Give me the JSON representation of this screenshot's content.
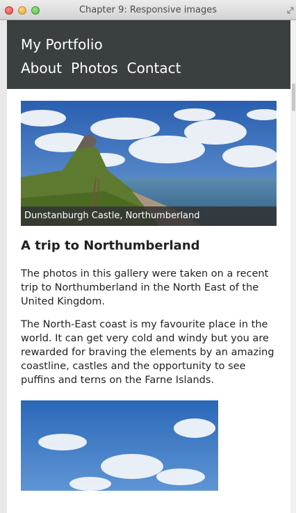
{
  "window": {
    "title": "Chapter 9: Responsive images"
  },
  "site": {
    "title": "My Portfolio",
    "nav": [
      "About",
      "Photos",
      "Contact"
    ]
  },
  "hero": {
    "caption": "Dunstanburgh Castle, Northumberland"
  },
  "article": {
    "heading": "A trip to Northumberland",
    "paragraphs": [
      "The photos in this gallery were taken on a recent trip to Northumberland in the North East of the United Kingdom.",
      "The North-East coast is my favourite place in the world. It can get very cold and windy but you are rewarded for braving the elements by an amazing coastline, castles and the opportunity to see puffins and terns on the Farne Islands."
    ]
  },
  "colors": {
    "header_bg": "#3a3f3f",
    "page_bg": "#ffffff"
  }
}
